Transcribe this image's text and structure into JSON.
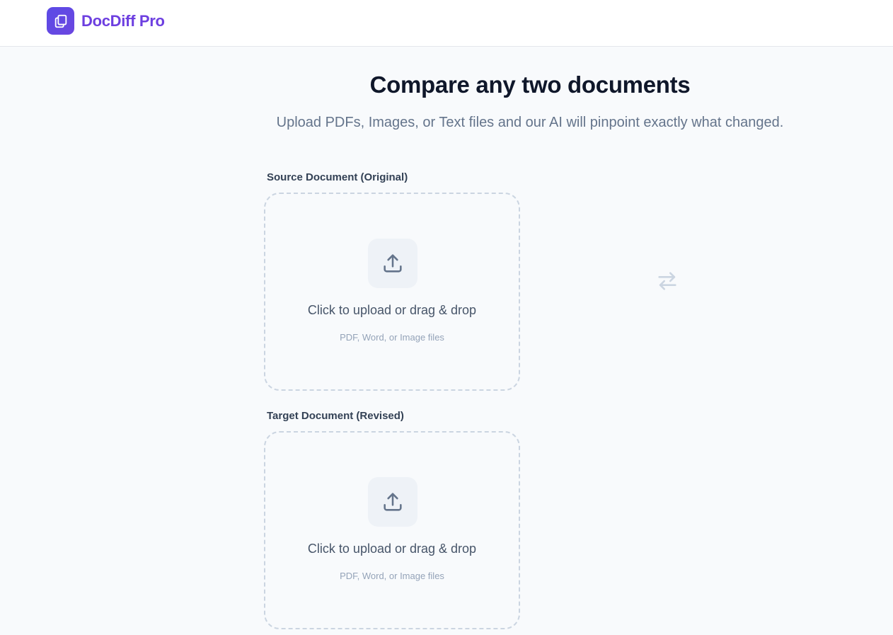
{
  "header": {
    "brand": "DocDiff Pro",
    "logo_icon": "copy-icon",
    "brand_color": "#6d3fe0"
  },
  "hero": {
    "title": "Compare any two documents",
    "subtitle": "Upload PDFs, Images, or Text files and our AI will pinpoint exactly what changed."
  },
  "source": {
    "label": "Source Document (Original)",
    "upload_text": "Click to upload or drag & drop",
    "file_types": "PDF, Word, or Image files",
    "icon": "upload-icon"
  },
  "target": {
    "label": "Target Document (Revised)",
    "upload_text": "Click to upload or drag & drop",
    "file_types": "PDF, Word, or Image files",
    "icon": "upload-icon"
  },
  "swap": {
    "icon": "swap-arrows-icon"
  }
}
